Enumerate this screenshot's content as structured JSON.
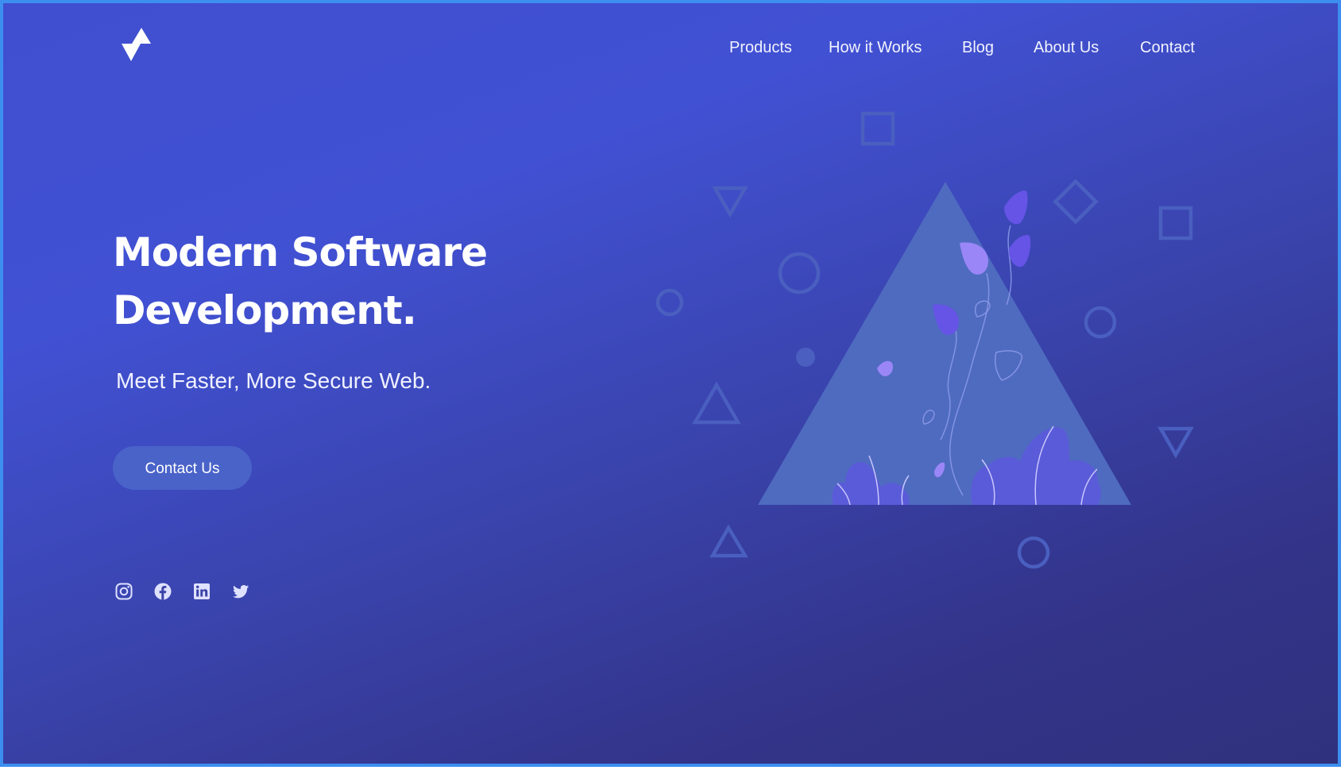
{
  "brand": {
    "logo_icon": "triangles-logo-icon"
  },
  "nav": {
    "items": [
      {
        "label": "Products"
      },
      {
        "label": "How it Works"
      },
      {
        "label": "Blog"
      },
      {
        "label": "About Us"
      },
      {
        "label": "Contact"
      }
    ]
  },
  "hero": {
    "title_line1": "Modern Software",
    "title_line2": "Development.",
    "subtitle": "Meet Faster, More Secure Web.",
    "cta_label": "Contact Us"
  },
  "social": [
    {
      "icon": "instagram-icon"
    },
    {
      "icon": "facebook-icon"
    },
    {
      "icon": "linkedin-icon"
    },
    {
      "icon": "twitter-icon"
    }
  ],
  "colors": {
    "background_start": "#4151d3",
    "background_end": "#30317d",
    "accent_button": "#4a63c9",
    "frame_border": "#3d8fef",
    "triangle_fill": "#4f6bc0",
    "leaf_light": "#8b7cf6",
    "leaf_dark": "#6554e6",
    "outline_shapes": "#4a5fc0"
  }
}
